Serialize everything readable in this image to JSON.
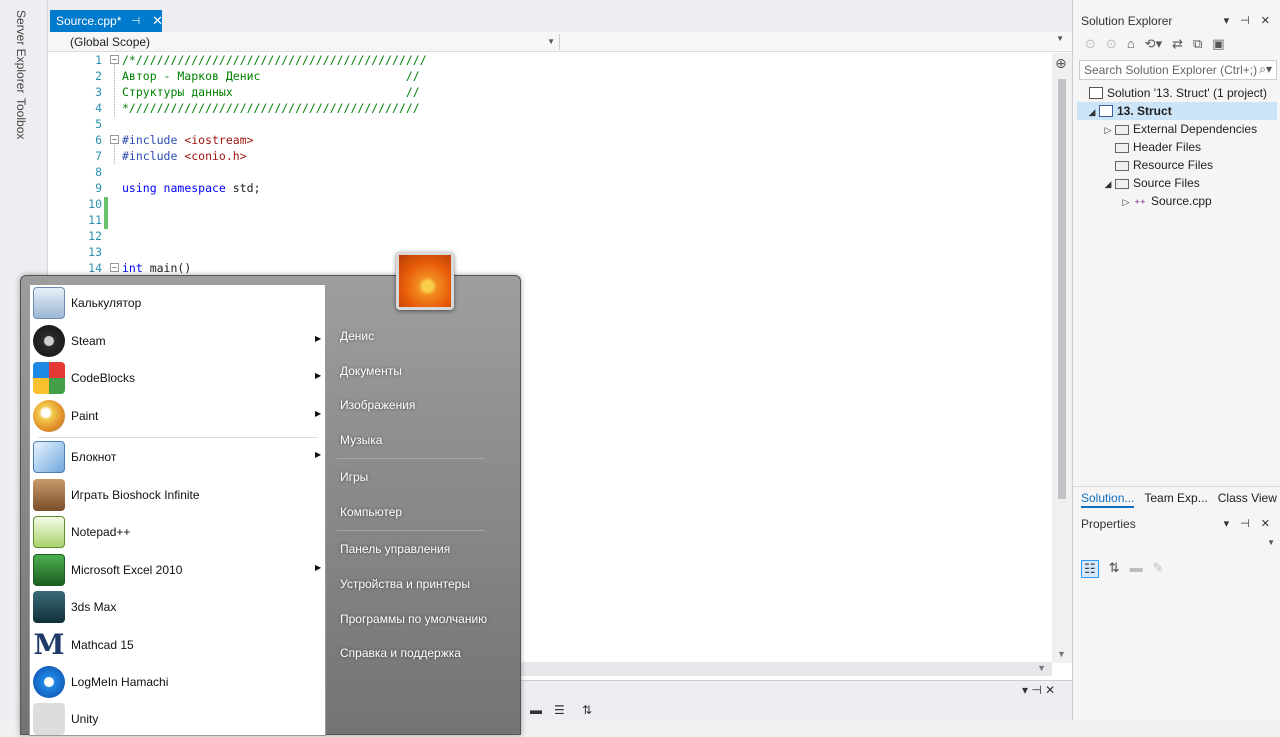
{
  "side_tabs": [
    "Server Explorer",
    "Toolbox"
  ],
  "editor": {
    "tab_label": "Source.cpp*",
    "tab_pin": "⊣",
    "tab_close": "✕",
    "scope_left": "(Global Scope)",
    "scope_right": "",
    "lines": [
      {
        "n": "1",
        "text": "/*//////////////////////////////////////////"
      },
      {
        "n": "2",
        "text": "Автор - Марков Денис                     //"
      },
      {
        "n": "3",
        "text": "Структуры данных                         //"
      },
      {
        "n": "4",
        "text": "*//////////////////////////////////////////"
      },
      {
        "n": "5",
        "text": ""
      },
      {
        "n": "6",
        "text_pp": "#include",
        "text_inc": " <iostream>"
      },
      {
        "n": "7",
        "text_pp": "#include",
        "text_inc": " <conio.h>"
      },
      {
        "n": "8",
        "text": ""
      },
      {
        "n": "9",
        "kw1": "using",
        "kw2": " namespace",
        "rest": " std;"
      },
      {
        "n": "10",
        "text": ""
      },
      {
        "n": "11",
        "text": ""
      },
      {
        "n": "12",
        "text": ""
      },
      {
        "n": "13",
        "text": ""
      },
      {
        "n": "14",
        "kw1": "int",
        "rest": " main()"
      }
    ]
  },
  "solution_explorer": {
    "title": "Solution Explorer",
    "controls": "▾ ⊣ ✕",
    "search_placeholder": "Search Solution Explorer (Ctrl+;)",
    "tree": {
      "solution": "Solution '13. Struct' (1 project)",
      "project": "13. Struct",
      "external_deps": "External Dependencies",
      "header_files": "Header Files",
      "resource_files": "Resource Files",
      "source_files": "Source Files",
      "source_cpp": "Source.cpp"
    },
    "bottom_tabs": [
      "Solution...",
      "Team Exp...",
      "Class View"
    ]
  },
  "properties": {
    "title": "Properties",
    "controls": "▾ ⊣ ✕"
  },
  "start_menu": {
    "programs": [
      {
        "label": "Калькулятор",
        "icon": "calculator-icon",
        "arrow": false
      },
      {
        "label": "Steam",
        "icon": "steam-icon",
        "arrow": true
      },
      {
        "label": "CodeBlocks",
        "icon": "codeblocks-icon",
        "arrow": true
      },
      {
        "label": "Paint",
        "icon": "paint-icon",
        "arrow": true
      },
      {
        "label": "Блокнот",
        "icon": "notepad-icon",
        "arrow": true
      },
      {
        "label": "Играть Bioshock Infinite",
        "icon": "bioshock-icon",
        "arrow": false
      },
      {
        "label": "Notepad++",
        "icon": "notepadpp-icon",
        "arrow": false
      },
      {
        "label": "Microsoft Excel 2010",
        "icon": "excel-icon",
        "arrow": true
      },
      {
        "label": "3ds Max",
        "icon": "3dsmax-icon",
        "arrow": false
      },
      {
        "label": "Mathcad 15",
        "icon": "mathcad-icon",
        "arrow": false
      },
      {
        "label": "LogMeIn Hamachi",
        "icon": "hamachi-icon",
        "arrow": false
      },
      {
        "label": "Unity",
        "icon": "unity-icon",
        "arrow": false
      }
    ],
    "right_items": [
      "Денис",
      "Документы",
      "Изображения",
      "Музыка",
      "Игры",
      "Компьютер",
      "Панель управления",
      "Устройства и принтеры",
      "Программы по умолчанию",
      "Справка и поддержка"
    ],
    "mathcad_letter": "M"
  },
  "bottom_panel": {
    "controls": "▾ ⊣ ✕"
  }
}
